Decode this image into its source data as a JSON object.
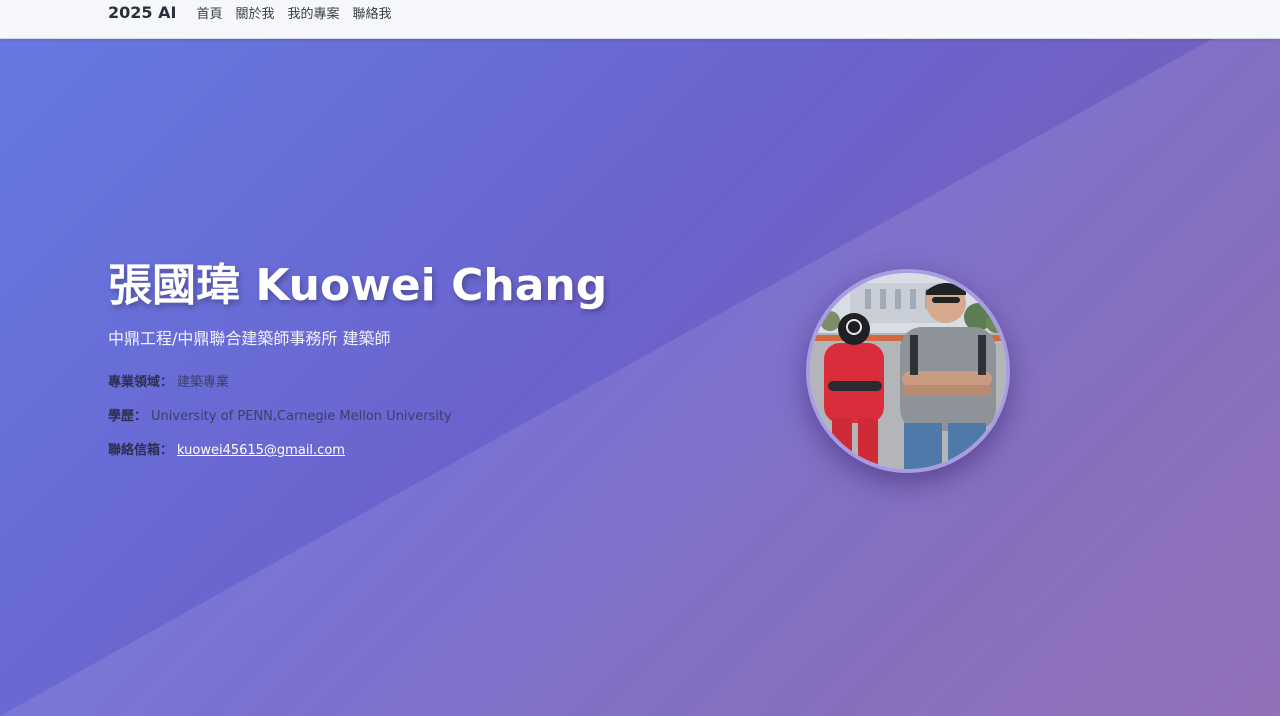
{
  "nav": {
    "brand": "2025 AI",
    "links": [
      "首頁",
      "關於我",
      "我的專案",
      "聯絡我"
    ]
  },
  "hero": {
    "name": "張國瑋 Kuowei Chang",
    "subtitle": "中鼎工程/中鼎聯合建築師事務所 建築師",
    "info": [
      {
        "label": "專業領域：",
        "value": "建築專業"
      },
      {
        "label": "學歷：",
        "value": "University of PENN,Carnegie Mellon University"
      },
      {
        "label": "聯絡信箱：",
        "value": "kuowei45615@gmail.com"
      }
    ]
  },
  "colors": {
    "gradient_start": "#6679e2",
    "gradient_end": "#8561b0",
    "avatar_border": "#a79de0"
  }
}
